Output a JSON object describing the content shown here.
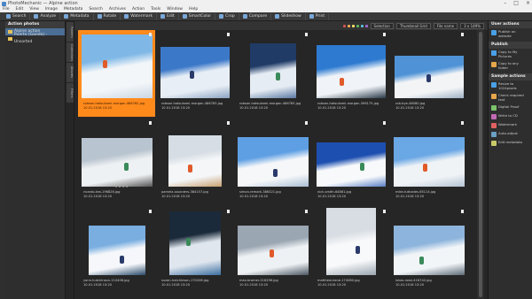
{
  "window": {
    "title": "PhotoMechanic — Alpine action"
  },
  "menu": [
    "File",
    "Edit",
    "View",
    "Image",
    "Metadata",
    "Search",
    "Archives",
    "Action",
    "Tools",
    "Window",
    "Help"
  ],
  "toolbar": [
    {
      "label": "Search",
      "icon": "search-icon"
    },
    {
      "label": "Analyze",
      "icon": "analyze-icon"
    },
    {
      "label": "Metadata",
      "icon": "metadata-icon"
    },
    {
      "label": "Rotate",
      "icon": "rotate-icon"
    },
    {
      "label": "Watermark",
      "icon": "watermark-icon"
    },
    {
      "label": "Edit",
      "icon": "edit-icon"
    },
    {
      "label": "SmartColor",
      "icon": "smartcolor-icon"
    },
    {
      "label": "Crop",
      "icon": "crop-icon"
    },
    {
      "label": "Compare",
      "icon": "compare-icon"
    },
    {
      "label": "Slideshow",
      "icon": "slideshow-icon"
    },
    {
      "label": "Print",
      "icon": "print-icon"
    }
  ],
  "left": {
    "title": "Action photos",
    "folders": [
      {
        "label": "Alpine action",
        "selected": true
      },
      {
        "label": "Puerto (Gando) - Unsorted",
        "selected": false
      }
    ]
  },
  "vtabs": [
    "Folders",
    "Collections",
    "Albums",
    "Filters"
  ],
  "controls": {
    "selection": "Selection",
    "view": "Thumbnail Grid",
    "sort": "File name",
    "zoom": "3 x 149%",
    "colors": [
      "#d9534f",
      "#f0ad4e",
      "#f7e36a",
      "#5cb85c",
      "#5bc0de",
      "#a36bd6"
    ]
  },
  "grid": [
    {
      "name": "robson-hatsukami-morgan-486762.jpg",
      "date": "10.01.2018 13:20",
      "selected": true
    },
    {
      "name": "robson-hatsukami-morgan-486783.jpg",
      "date": "10.01.2018 13:20",
      "selected": false
    },
    {
      "name": "robson-hatsukami-morgan-486785.jpg",
      "date": "10.01.2018 13:20",
      "selected": false
    },
    {
      "name": "robson-hatsukami-morgan-396175.jpg",
      "date": "10.01.2018 13:20",
      "selected": false
    },
    {
      "name": "rob-bye-48080.jpg",
      "date": "10.01.2018 13:20",
      "selected": false
    },
    {
      "name": "ricardo-tea-196826.jpg",
      "date": "10.01.2018 13:20",
      "selected": false,
      "stars": "★★★★"
    },
    {
      "name": "pamela-saunders-384157.jpg",
      "date": "10.01.2018 13:20",
      "selected": false
    },
    {
      "name": "simon-remark-386321.jpg",
      "date": "10.01.2018 13:20",
      "selected": false
    },
    {
      "name": "nick-smith-64861.jpg",
      "date": "10.01.2018 13:20",
      "selected": false
    },
    {
      "name": "mike-tuthades-65114.jpg",
      "date": "10.01.2018 13:20",
      "selected": false
    },
    {
      "name": "yann-hutchinson-110406.jpg",
      "date": "10.01.2018 13:20",
      "selected": false
    },
    {
      "name": "suzan-hutchinson-170206.jpg",
      "date": "10.01.2018 13:20",
      "selected": false
    },
    {
      "name": "max-bramer-216296.jpg",
      "date": "10.01.2018 13:20",
      "selected": false
    },
    {
      "name": "matthew-kane-174080.jpg",
      "date": "10.01.2018 13:20",
      "selected": false
    },
    {
      "name": "lukas-rossi-418742.jpg",
      "date": "10.01.2018 13:20",
      "selected": false
    }
  ],
  "right": {
    "user": {
      "title": "User actions",
      "items": [
        {
          "label": "Publish on website",
          "icon": "publish-icon"
        }
      ]
    },
    "publish": {
      "title": "Publish",
      "items": [
        {
          "label": "Copy to My Pictures",
          "icon": "folder-icon"
        },
        {
          "label": "Copy to any folder",
          "icon": "folder-icon"
        }
      ]
    },
    "sample": {
      "title": "Sample actions",
      "items": [
        {
          "label": "Resize to 1024pixels",
          "icon": "resize-icon"
        },
        {
          "label": "Check required text",
          "icon": "check-icon"
        },
        {
          "label": "Digital Proof",
          "icon": "proof-icon"
        },
        {
          "label": "Write to CD",
          "icon": "cd-icon"
        },
        {
          "label": "Watermark",
          "icon": "watermark-icon"
        },
        {
          "label": "Auto-adjust",
          "icon": "auto-icon"
        },
        {
          "label": "Edit metadata",
          "icon": "metadata-icon"
        }
      ]
    }
  }
}
